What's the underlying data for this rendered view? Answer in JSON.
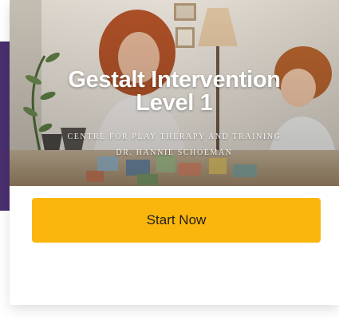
{
  "course": {
    "title_line1": "Gestalt Intervention",
    "title_line2": "Level 1",
    "subtitle_line1": "Centre for Play Therapy and Training",
    "subtitle_line2": "Dr. Hannie Schoeman"
  },
  "actions": {
    "start_label": "Start Now"
  },
  "colors": {
    "accent": "#4a2f6e",
    "button": "#fbb60d",
    "button_text": "#1e1e1e"
  }
}
